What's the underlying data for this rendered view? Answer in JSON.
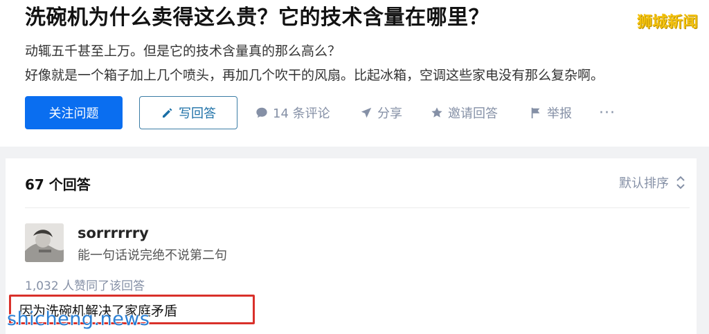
{
  "question": {
    "title": "洗碗机为什么卖得这么贵？它的技术含量在哪里？",
    "desc_line_1": "动辄五千甚至上万。但是它的技术含量真的那么高么？",
    "desc_line_2": "好像就是一个箱子加上几个喷头，再加几个吹干的风扇。比起冰箱，空调这些家电没有那么复杂啊。"
  },
  "actions": {
    "follow_label": "关注问题",
    "answer_label": "写回答",
    "comment_label": "14 条评论",
    "share_label": "分享",
    "invite_label": "邀请回答",
    "report_label": "举报",
    "more_label": "···",
    "icons": [
      "pencil-icon",
      "comment-bubble-icon",
      "paper-plane-icon",
      "star-icon",
      "flag-icon",
      "more-dots-icon"
    ]
  },
  "answers": {
    "count_label": "67 个回答",
    "sort_label": "默认排序",
    "sort_icon": "up-down-chevron-icon"
  },
  "answer": {
    "author_name": "sorrrrrry",
    "author_bio": "能一句话说完绝不说第二句",
    "vote_text": "1,032 人赞同了该回答",
    "content": "因为洗碗机解决了家庭矛盾"
  },
  "watermarks": {
    "top": "狮城新闻",
    "bottom": "shicheng.news"
  },
  "colors": {
    "primary": "#0a6ef0",
    "muted": "#8590a6",
    "highlight_border": "#d9302a",
    "watermark_top": "#f4c20d",
    "watermark_bottom": "#2a7fd4"
  }
}
